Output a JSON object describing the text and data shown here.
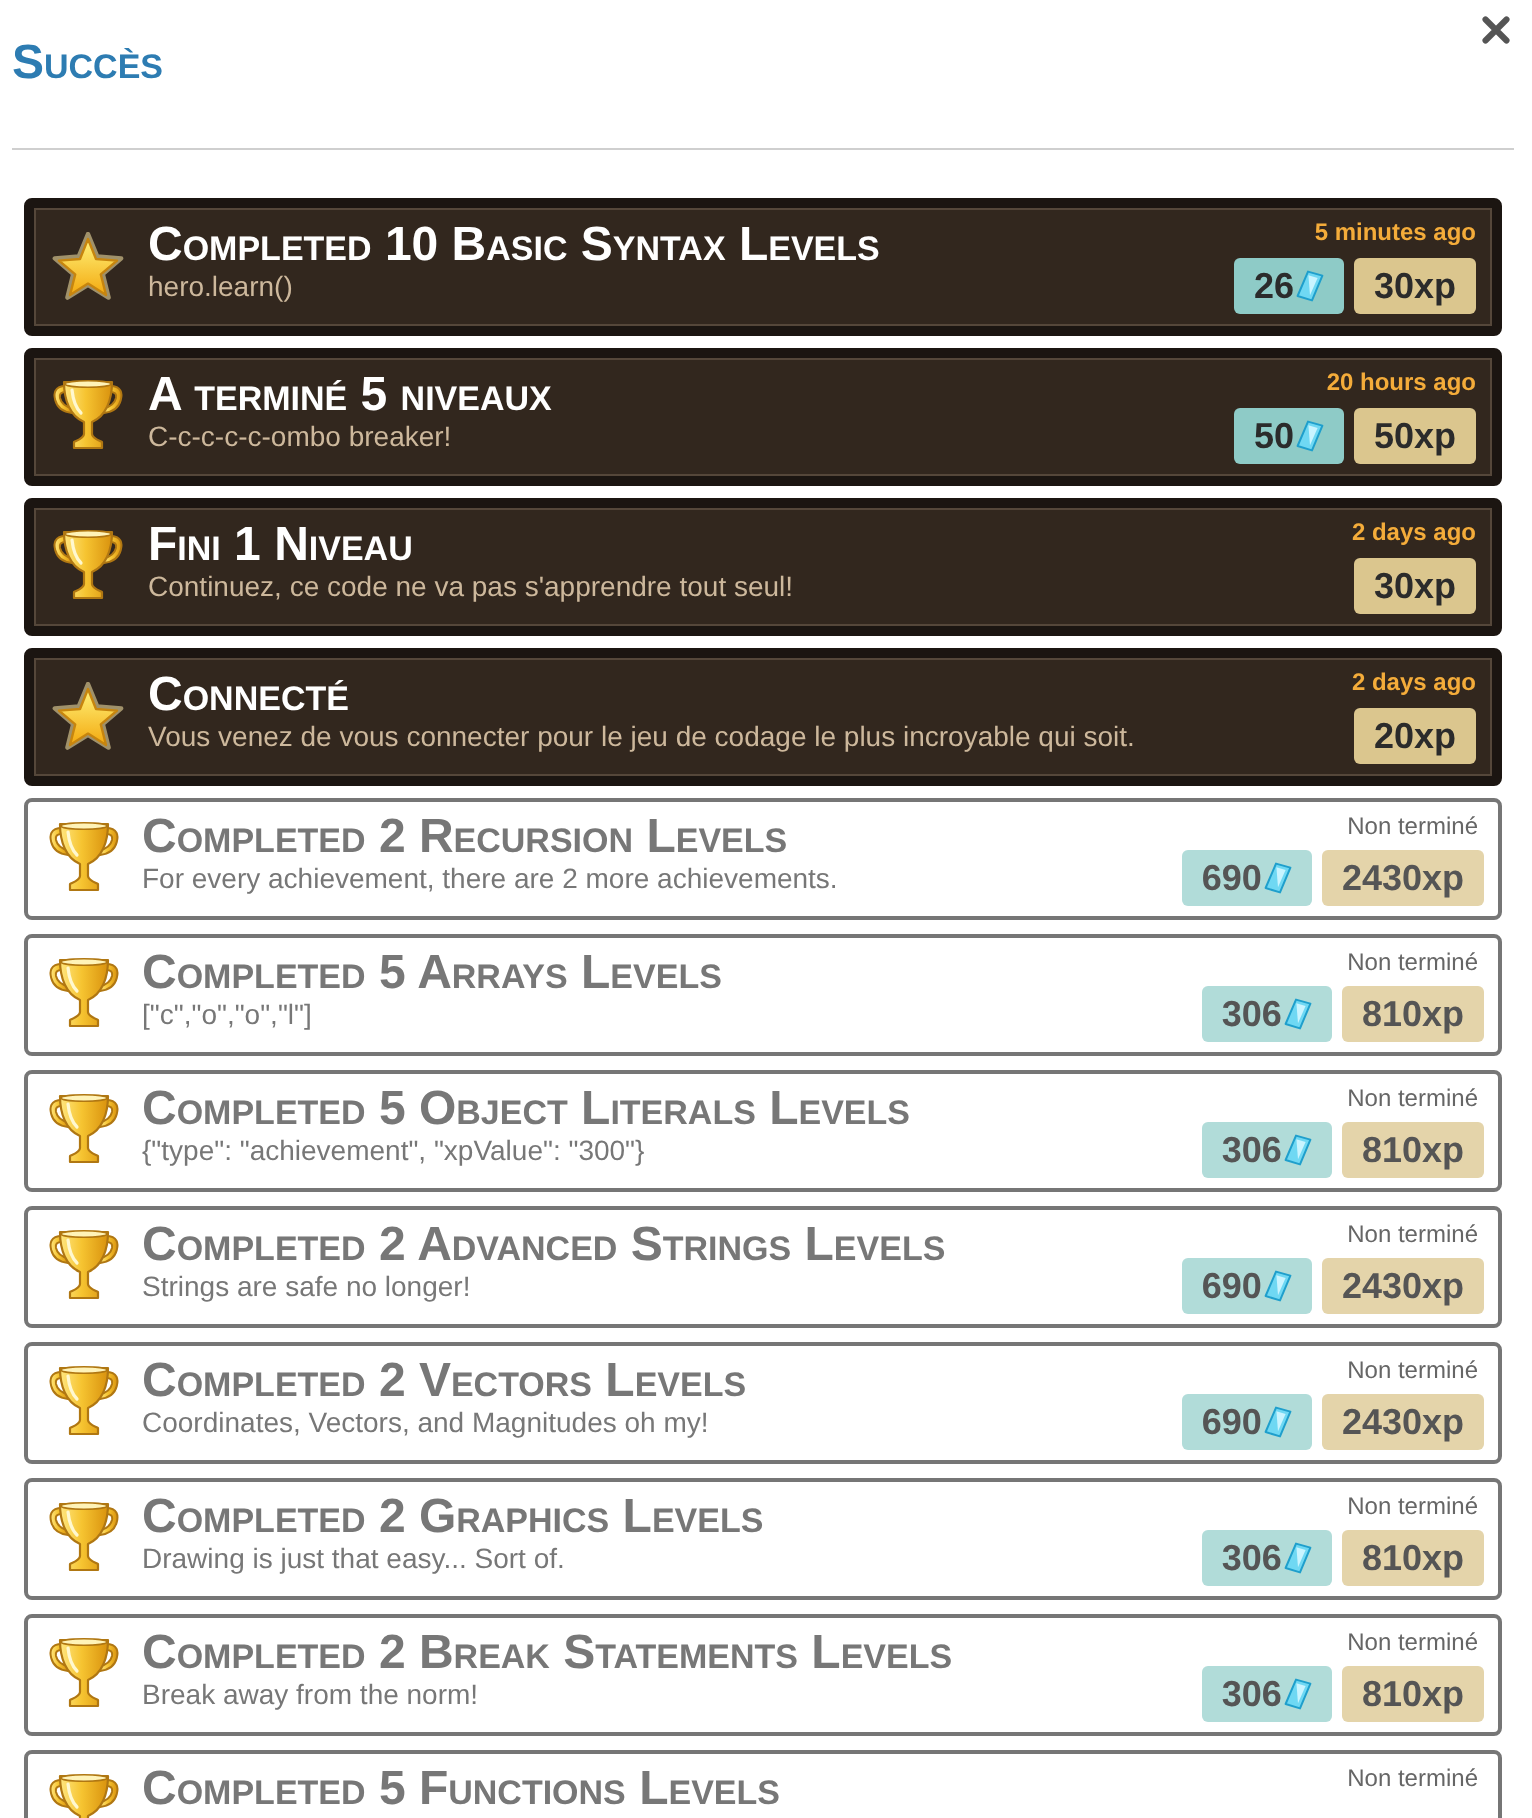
{
  "dialog": {
    "title": "Succès"
  },
  "achievements": [
    {
      "kind": "star",
      "completed": true,
      "title": "Completed 10 Basic Syntax Levels",
      "description": "hero.learn()",
      "status": "5 minutes ago",
      "gems": "26",
      "xp": "30xp"
    },
    {
      "kind": "trophy",
      "completed": true,
      "title": "A terminé 5 niveaux",
      "description": "C-c-c-c-c-ombo breaker!",
      "status": "20 hours ago",
      "gems": "50",
      "xp": "50xp"
    },
    {
      "kind": "trophy",
      "completed": true,
      "title": "Fini 1 Niveau",
      "description": "Continuez, ce code ne va pas s'apprendre tout seul!",
      "status": "2 days ago",
      "xp": "30xp"
    },
    {
      "kind": "star",
      "completed": true,
      "title": "Connecté",
      "description": "Vous venez de vous connecter pour le jeu de codage le plus incroyable qui soit.",
      "status": "2 days ago",
      "xp": "20xp"
    },
    {
      "kind": "trophy",
      "completed": false,
      "title": "Completed 2 Recursion Levels",
      "description": "For every achievement, there are 2 more achievements.",
      "status": "Non terminé",
      "gems": "690",
      "xp": "2430xp"
    },
    {
      "kind": "trophy",
      "completed": false,
      "title": "Completed 5 Arrays Levels",
      "description": "[\"c\",\"o\",\"o\",\"l\"]",
      "status": "Non terminé",
      "gems": "306",
      "xp": "810xp"
    },
    {
      "kind": "trophy",
      "completed": false,
      "title": "Completed 5 Object Literals Levels",
      "description": "{\"type\": \"achievement\", \"xpValue\": \"300\"}",
      "status": "Non terminé",
      "gems": "306",
      "xp": "810xp"
    },
    {
      "kind": "trophy",
      "completed": false,
      "title": "Completed 2 Advanced Strings Levels",
      "description": "Strings are safe no longer!",
      "status": "Non terminé",
      "gems": "690",
      "xp": "2430xp"
    },
    {
      "kind": "trophy",
      "completed": false,
      "title": "Completed 2 Vectors Levels",
      "description": "Coordinates, Vectors, and Magnitudes oh my!",
      "status": "Non terminé",
      "gems": "690",
      "xp": "2430xp"
    },
    {
      "kind": "trophy",
      "completed": false,
      "title": "Completed 2 Graphics Levels",
      "description": "Drawing is just that easy... Sort of.",
      "status": "Non terminé",
      "gems": "306",
      "xp": "810xp"
    },
    {
      "kind": "trophy",
      "completed": false,
      "title": "Completed 2 Break Statements Levels",
      "description": "Break away from the norm!",
      "status": "Non terminé",
      "gems": "306",
      "xp": "810xp"
    },
    {
      "kind": "trophy",
      "completed": false,
      "title": "Completed 5 Functions Levels",
      "status": "Non terminé"
    }
  ]
}
